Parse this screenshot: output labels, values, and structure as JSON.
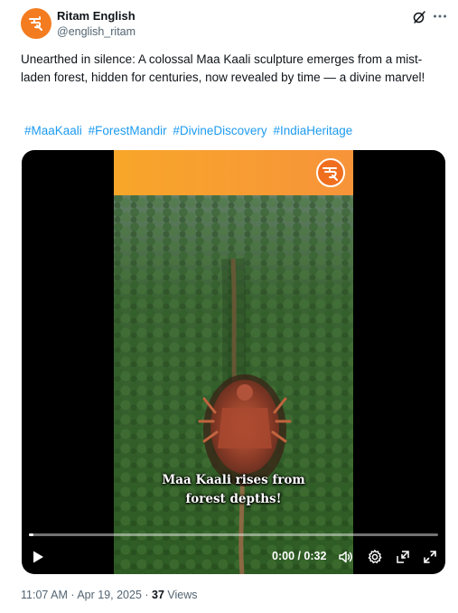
{
  "author": {
    "name": "Ritam English",
    "handle": "@english_ritam"
  },
  "tweet": {
    "text": "Unearthed in silence: A colossal Maa Kaali sculpture emerges from a mist-laden forest, hidden for centuries, now revealed by time — a divine marvel!",
    "hashtags": [
      "#MaaKaali",
      "#ForestMandir",
      "#DivineDiscovery",
      "#IndiaHeritage"
    ]
  },
  "video": {
    "caption_line1": "Maa Kaali rises from",
    "caption_line2": "forest depths!",
    "time": "0:00 / 0:32",
    "progress": 0.01
  },
  "footer": {
    "time": "11:07 AM",
    "separator1": " · ",
    "date": "Apr 19, 2025",
    "separator2": " · ",
    "views_count": "37",
    "views_label": " Views"
  },
  "colors": {
    "brand_orange": "#f47c20",
    "link_blue": "#1d9bf0",
    "secondary_text": "#536471"
  },
  "icons": {
    "avatar": "ritam-logo-icon",
    "grok": "grok-icon",
    "more": "more-icon",
    "play": "play-icon",
    "volume": "volume-icon",
    "settings": "gear-icon",
    "popout": "picture-in-picture-icon",
    "fullscreen": "fullscreen-icon"
  }
}
